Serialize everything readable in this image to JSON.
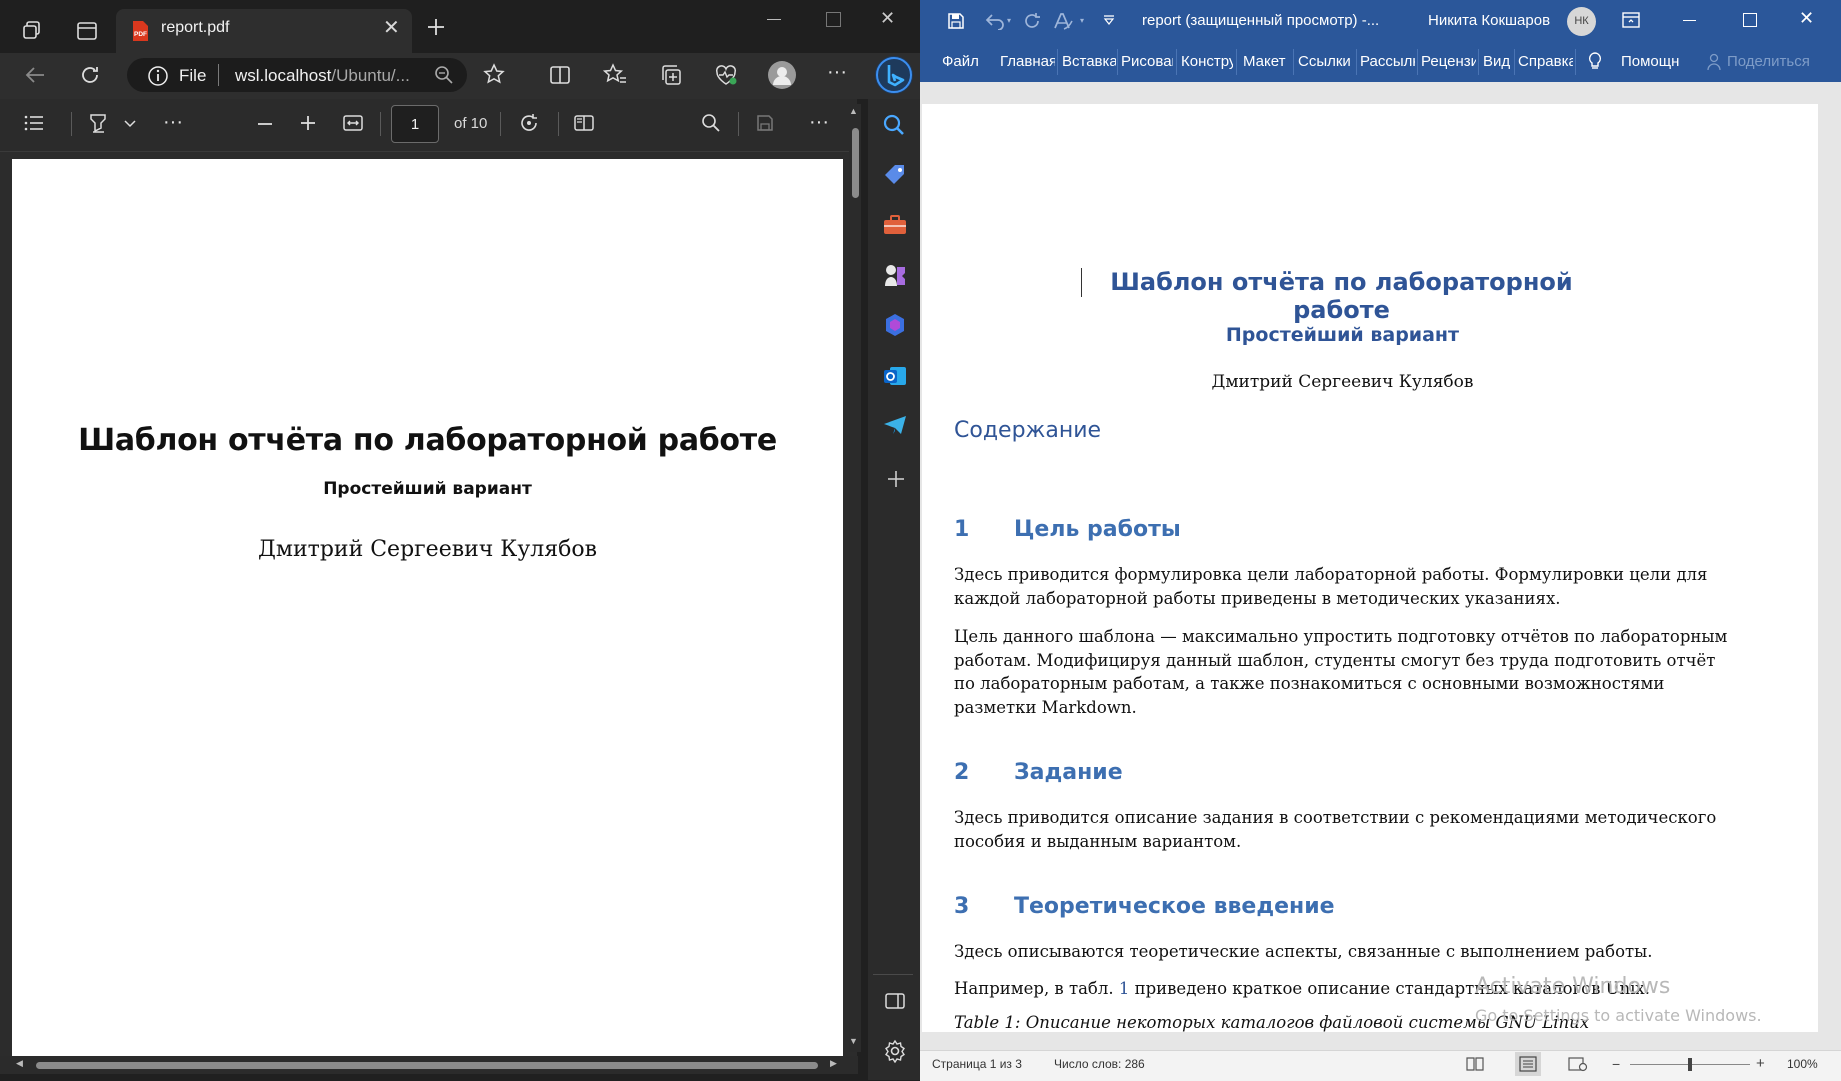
{
  "edge": {
    "tab_title": "report.pdf",
    "address_scheme": "File",
    "address_host": "wsl.localhost",
    "address_path": "/Ubuntu/...",
    "pdf_toolbar": {
      "page_number": "1",
      "page_total": "of 10"
    },
    "pdf_content": {
      "title": "Шаблон отчёта по лабораторной работе",
      "subtitle": "Простейший вариант",
      "author": "Дмитрий Сергеевич Кулябов"
    }
  },
  "word": {
    "window_title": "report (защищенный просмотр)  -...",
    "user_name": "Никита Кокшаров",
    "user_initials": "НК",
    "ribbon_tabs": [
      "Файл",
      "Главная",
      "Вставка",
      "Рисован",
      "Констру",
      "Макет",
      "Ссылки",
      "Рассылк",
      "Рецензи",
      "Вид",
      "Справка"
    ],
    "tell_me": "Помощн",
    "share": "Поделиться",
    "document": {
      "title": "Шаблон отчёта по лабораторной работе",
      "subtitle": "Простейший вариант",
      "author": "Дмитрий Сергеевич Кулябов",
      "toc_heading": "Содержание",
      "sections": [
        {
          "number": "1",
          "title": "Цель работы",
          "paragraphs": [
            "Здесь приводится формулировка цели лабораторной работы. Формулировки цели для каждой лабораторной работы приведены в методических указаниях.",
            "Цель данного шаблона — максимально упростить подготовку отчётов по лабораторным работам. Модифицируя данный шаблон, студенты смогут без труда подготовить отчёт по лабораторным работам, а также познакомиться с основными возможностями разметки Markdown."
          ]
        },
        {
          "number": "2",
          "title": "Задание",
          "paragraphs": [
            "Здесь приводится описание задания в соответствии с рекомендациями методического пособия и выданным вариантом."
          ]
        },
        {
          "number": "3",
          "title": "Теоретическое введение",
          "paragraphs": [
            "Здесь описываются теоретические аспекты, связанные с выполнением работы."
          ]
        }
      ],
      "table_ref_before": "Например, в табл. ",
      "table_ref_num": "1",
      "table_ref_after": " приведено краткое описание стандартных каталогов Unix.",
      "table_caption": "Table 1: Описание некоторых каталогов файловой системы GNU Linux"
    },
    "status_bar": {
      "page_info": "Страница 1 из 3",
      "word_count": "Число слов: 286",
      "zoom": "100%"
    },
    "watermark": {
      "line1": "Activate Windows",
      "line2": "Go to Settings to activate Windows."
    }
  },
  "colors": {
    "word_blue": "#2b579a",
    "heading_blue": "#2f5496",
    "edge_dark": "#202020"
  }
}
